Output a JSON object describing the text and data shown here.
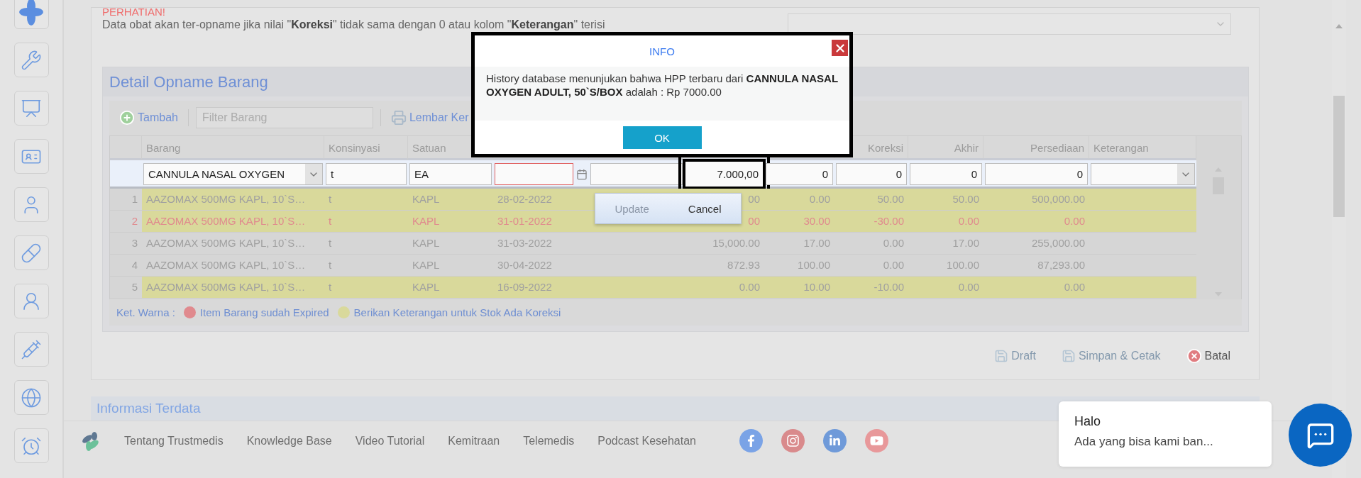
{
  "sidebar": {
    "items": [
      {
        "kind": "logo"
      },
      {
        "kind": "tools"
      },
      {
        "kind": "presentation"
      },
      {
        "kind": "id-card"
      },
      {
        "kind": "user"
      },
      {
        "kind": "pill"
      },
      {
        "kind": "user-round"
      },
      {
        "kind": "syringe"
      },
      {
        "kind": "globe"
      },
      {
        "kind": "alarm"
      }
    ]
  },
  "notice": {
    "title": "PERHATIAN!",
    "text": "Data obat akan ter-opname jika nilai \"**Koreksi**\" tidak sama dengan 0 atau kolom \"**Keterangan**\" terisi"
  },
  "detail": {
    "title": "Detail Opname Barang",
    "toolbar": {
      "add": "Tambah",
      "filter_placeholder": "Filter Barang",
      "worksheet": "Lembar Ker"
    },
    "table": {
      "columns": [
        "Barang",
        "Konsinyasi",
        "Satuan",
        "Koreksi",
        "Akhir",
        "Persediaan",
        "Keterangan"
      ],
      "edit_row": {
        "barang": "CANNULA NASAL OXYGEN",
        "konsinyasi": "t",
        "satuan": "EA",
        "column_4": {
          "invalid": true
        },
        "column_6": {
          "value": "7.000,00",
          "highlighted": true
        },
        "column_7": "0",
        "koreksi": "0",
        "akhir": "0",
        "persediaan": "0"
      },
      "rows": [
        {
          "number": "1",
          "barang": "AAZOMAX 500MG KAPL, 10`S…",
          "konsinyasi": "t",
          "satuan": "KAPL",
          "column_4": "28-02-2022",
          "column_6": "00",
          "column_7": "0.00",
          "koreksi": "50.00",
          "akhir": "50.00",
          "persediaan": "500,000.00",
          "expired": false,
          "needs_note": true
        },
        {
          "number": "2",
          "barang": "AAZOMAX 500MG KAPL, 10`S…",
          "konsinyasi": "t",
          "satuan": "KAPL",
          "column_4": "31-01-2022",
          "column_6": "00",
          "column_7": "30.00",
          "koreksi": "-30.00",
          "akhir": "0.00",
          "persediaan": "0.00",
          "expired": true,
          "needs_note": true
        },
        {
          "number": "3",
          "barang": "AAZOMAX 500MG KAPL, 10`S…",
          "konsinyasi": "t",
          "satuan": "KAPL",
          "column_4": "31-03-2022",
          "column_6": "15,000.00",
          "column_7": "17.00",
          "koreksi": "0.00",
          "akhir": "17.00",
          "persediaan": "255,000.00",
          "expired": false,
          "needs_note": false
        },
        {
          "number": "4",
          "barang": "AAZOMAX 500MG KAPL, 10`S…",
          "konsinyasi": "t",
          "satuan": "KAPL",
          "column_4": "30-04-2022",
          "column_6": "872.93",
          "column_7": "100.00",
          "koreksi": "0.00",
          "akhir": "100.00",
          "persediaan": "87,293.00",
          "expired": false,
          "needs_note": false
        },
        {
          "number": "5",
          "barang": "AAZOMAX 500MG KAPL, 10`S…",
          "konsinyasi": "t",
          "satuan": "KAPL",
          "column_4": "16-09-2022",
          "column_6": "0.00",
          "column_7": "10.00",
          "koreksi": "-10.00",
          "akhir": "0.00",
          "persediaan": "0.00",
          "expired": false,
          "needs_note": true
        }
      ],
      "row_menu": [
        {
          "label": "Update",
          "disabled": true
        },
        {
          "label": "Cancel",
          "disabled": false
        }
      ]
    },
    "legend": {
      "title": "Ket. Warna :",
      "items": [
        {
          "label": "Item Barang sudah Expired",
          "color": "#e08a8e"
        },
        {
          "label": "Berikan Keterangan untuk Stok Ada Koreksi",
          "color": "#d9d99b"
        }
      ]
    }
  },
  "actions": [
    {
      "label": "Draft",
      "kind": "save",
      "disabled": true
    },
    {
      "label": "Simpan & Cetak",
      "kind": "save",
      "disabled": true
    },
    {
      "label": "Batal",
      "kind": "cancel",
      "disabled": false
    }
  ],
  "info_section": {
    "title": "Informasi Terdata"
  },
  "footer": {
    "links": [
      "Tentang Trustmedis",
      "Knowledge Base",
      "Video Tutorial",
      "Kemitraan",
      "Telemedis",
      "Podcast Kesehatan"
    ],
    "social": [
      {
        "kind": "facebook"
      },
      {
        "kind": "instagram"
      },
      {
        "kind": "linkedin"
      },
      {
        "kind": "youtube"
      }
    ]
  },
  "modal": {
    "title": "INFO",
    "message": "History database menunjukan bahwa HPP terbaru dari **CANNULA NASAL OXYGEN ADULT, 50`S/BOX** adalah : Rp 7000.00",
    "button": "OK"
  },
  "chat": {
    "title": "Halo",
    "message": "Ada yang bisa kami ban..."
  }
}
